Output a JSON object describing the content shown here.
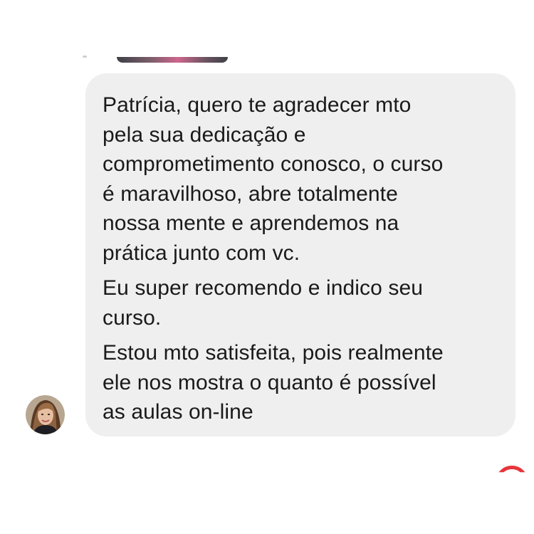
{
  "message": {
    "paragraphs": [
      [
        "Patrícia, quero te agradecer mto",
        "pela sua dedicação e",
        "comprometimento conosco, o curso",
        "é maravilhoso, abre totalmente",
        "nossa mente e aprendemos na",
        "prática junto com vc."
      ],
      [
        "Eu super recomendo e indico seu",
        "curso."
      ],
      [
        "Estou mto satisfeita, pois realmente",
        "ele nos mostra o quanto é possível",
        "as aulas on-line"
      ]
    ]
  },
  "icons": {
    "avatar": "user-avatar-photo",
    "reaction": "heart-reaction-icon"
  },
  "colors": {
    "bubble_bg": "#efeff0",
    "text": "#1a1a1a",
    "reaction": "#e8343c"
  }
}
